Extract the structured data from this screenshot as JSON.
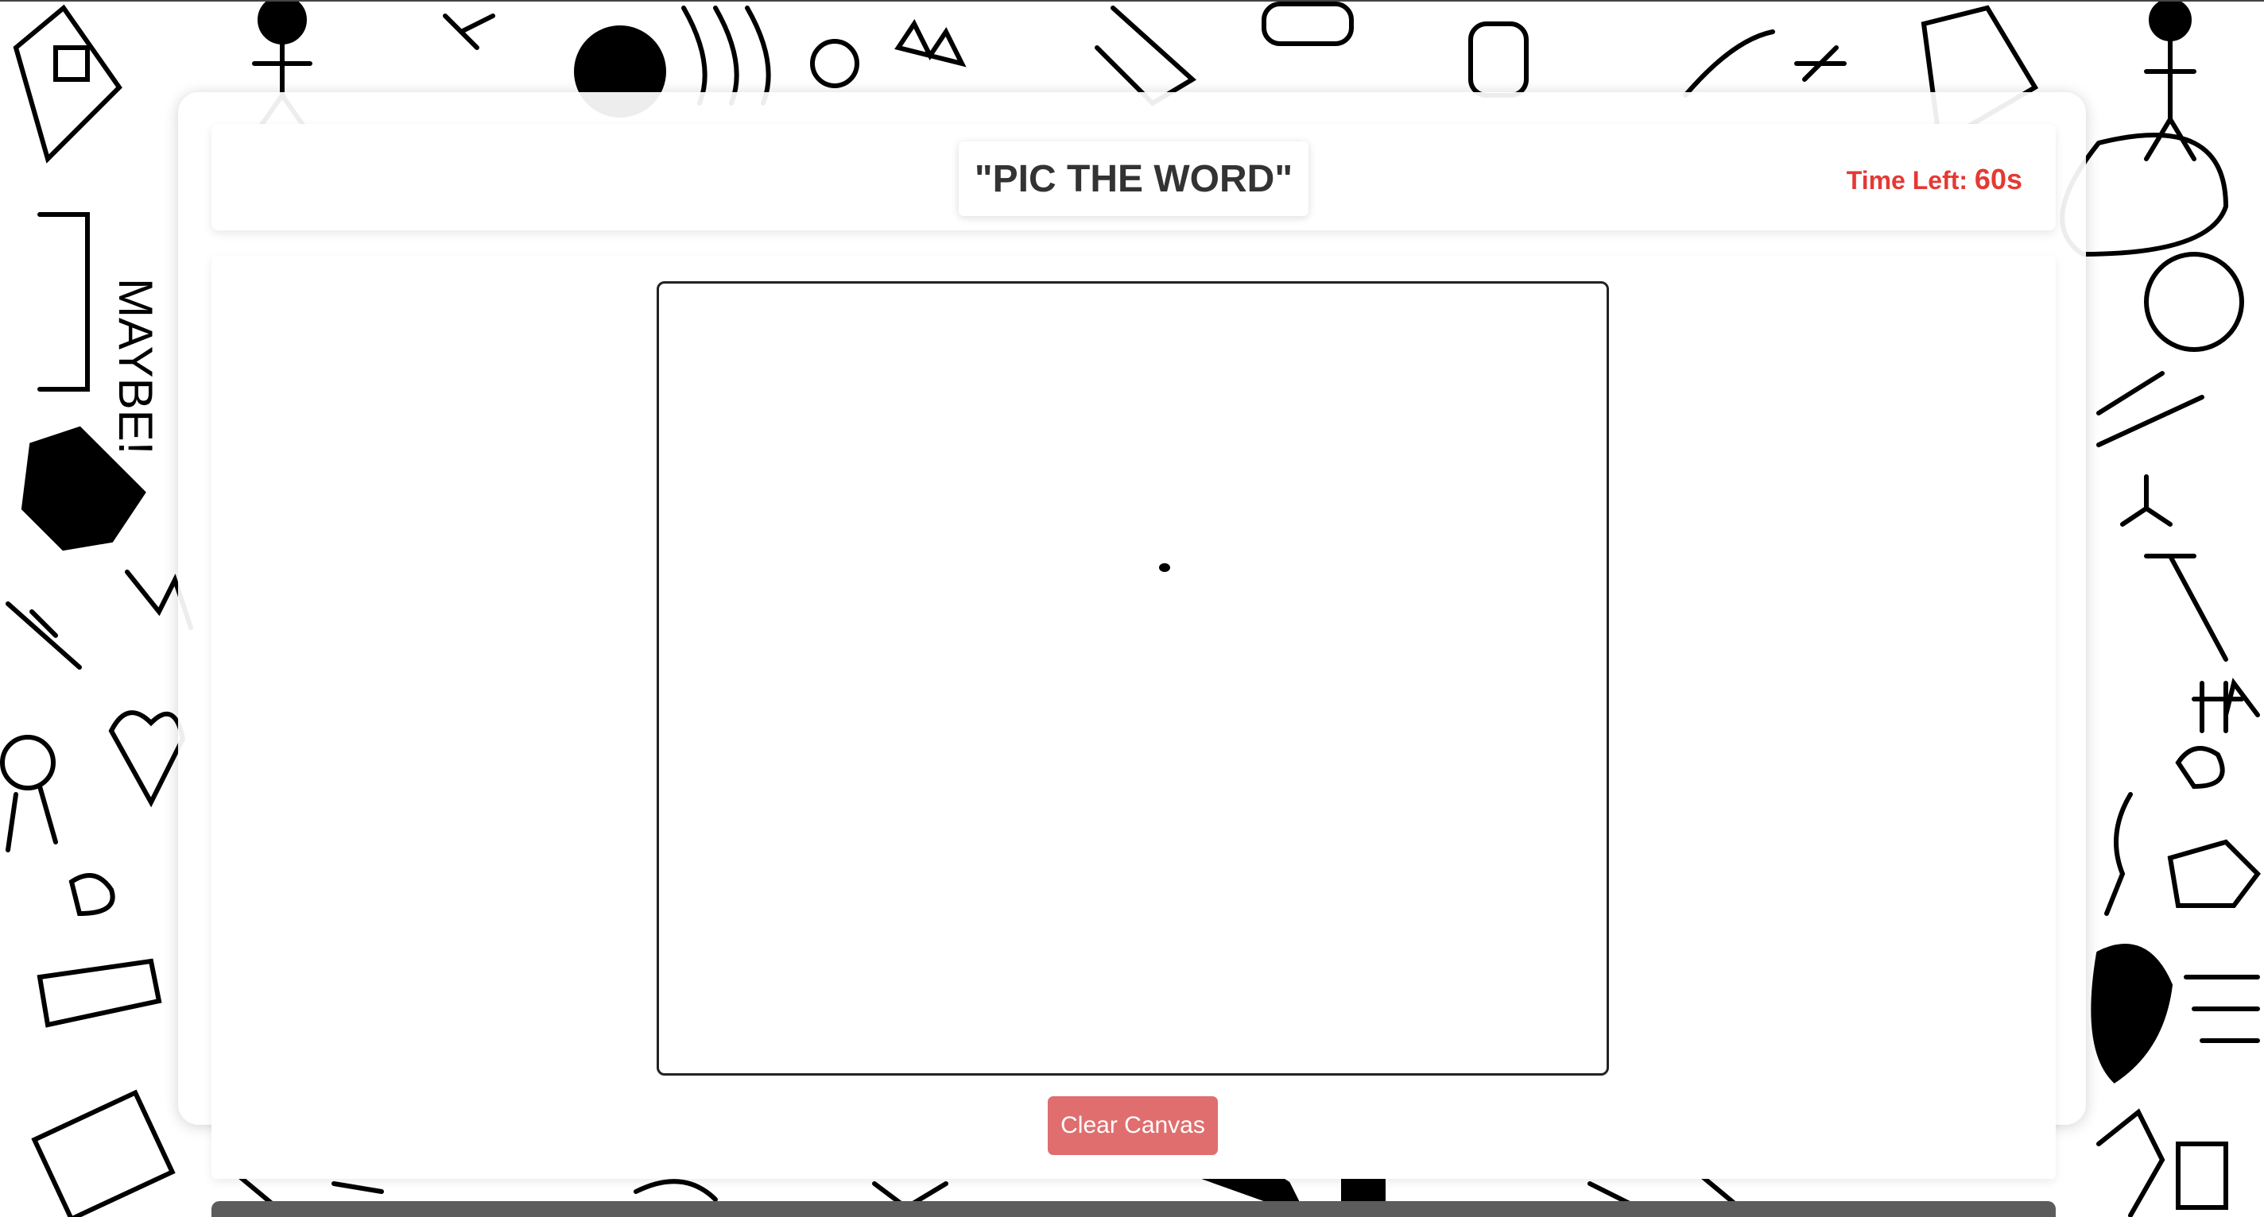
{
  "game": {
    "word": "\"PIC THE WORD\"",
    "timer_label": "Time Left:",
    "timer_value": "60s"
  },
  "canvas": {
    "clear_label": "Clear Canvas"
  },
  "colors": {
    "timer": "#e53935",
    "clear_button": "#e06e6e",
    "title": "#333333"
  }
}
